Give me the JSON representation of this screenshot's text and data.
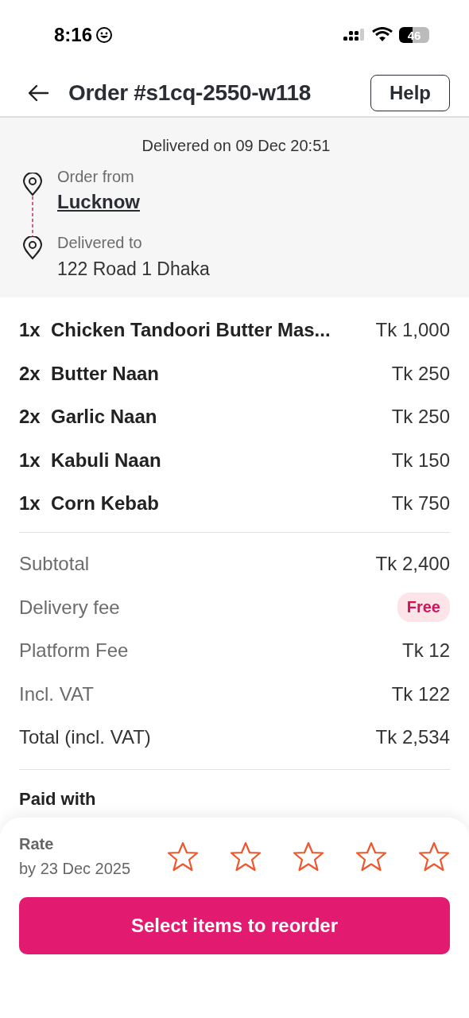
{
  "status_bar": {
    "time": "8:16",
    "battery": "46"
  },
  "header": {
    "title": "Order #s1cq-2550-w118",
    "help": "Help"
  },
  "delivery": {
    "delivered_on": "Delivered on 09 Dec 20:51",
    "from_label": "Order from",
    "from": "Lucknow",
    "to_label": "Delivered to",
    "to": "122 Road 1 Dhaka"
  },
  "items": [
    {
      "qty": "1x",
      "name": "Chicken Tandoori Butter Mas...",
      "price": "Tk 1,000"
    },
    {
      "qty": "2x",
      "name": "Butter Naan",
      "price": "Tk 250"
    },
    {
      "qty": "2x",
      "name": "Garlic Naan",
      "price": "Tk 250"
    },
    {
      "qty": "1x",
      "name": "Kabuli Naan",
      "price": "Tk 150"
    },
    {
      "qty": "1x",
      "name": "Corn Kebab",
      "price": "Tk 750"
    }
  ],
  "summary": [
    {
      "label": "Subtotal",
      "value": "Tk 2,400",
      "kind": "plain"
    },
    {
      "label": "Delivery fee",
      "value": "Free",
      "kind": "badge"
    },
    {
      "label": "Platform Fee",
      "value": "Tk 12",
      "kind": "plain"
    },
    {
      "label": "Incl. VAT",
      "value": "Tk 122",
      "kind": "plain"
    },
    {
      "label": "Total (incl. VAT)",
      "value": "Tk 2,534",
      "kind": "total"
    }
  ],
  "payment": {
    "title": "Paid with"
  },
  "rating": {
    "title": "Rate",
    "deadline": "by 23 Dec 2025",
    "stars": 0
  },
  "reorder_button": "Select items to reorder"
}
